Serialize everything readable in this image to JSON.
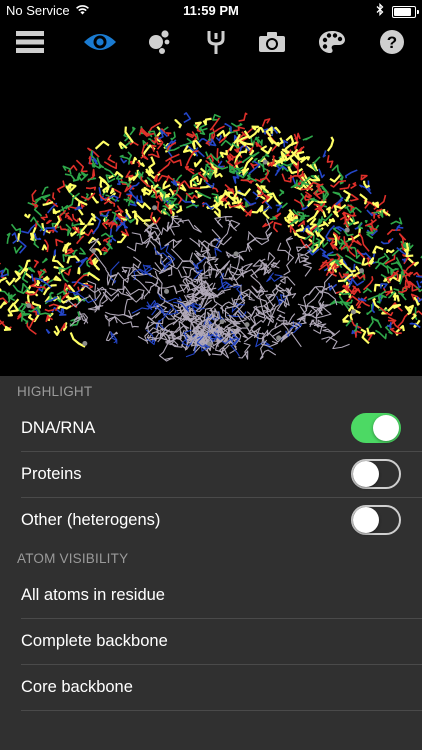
{
  "status_bar": {
    "carrier": "No Service",
    "time": "11:59 PM",
    "battery_level": 0.95
  },
  "toolbar": {
    "items": [
      {
        "icon": "menu-icon",
        "active": false
      },
      {
        "icon": "eye-icon",
        "active": true
      },
      {
        "icon": "molecule-icon",
        "active": false
      },
      {
        "icon": "tuning-fork-icon",
        "active": false
      },
      {
        "icon": "camera-icon",
        "active": false
      },
      {
        "icon": "palette-icon",
        "active": false
      },
      {
        "icon": "help-icon",
        "active": false
      }
    ],
    "active_color": "#1a7bd1"
  },
  "highlight": {
    "header": "HIGHLIGHT",
    "items": [
      {
        "label": "DNA/RNA",
        "on": true
      },
      {
        "label": "Proteins",
        "on": false
      },
      {
        "label": "Other (heterogens)",
        "on": false
      }
    ]
  },
  "atom_visibility": {
    "header": "ATOM VISIBILITY",
    "items": [
      {
        "label": "All atoms in residue"
      },
      {
        "label": "Complete backbone"
      },
      {
        "label": "Core backbone"
      }
    ]
  },
  "colors": {
    "panel": "#303030",
    "toggle_on": "#4cd964",
    "dna_yellow": "#ffff66",
    "red": "#e0302a",
    "green": "#2fa84a",
    "blue": "#2446c8",
    "protein_gray": "#b0a8b8"
  }
}
